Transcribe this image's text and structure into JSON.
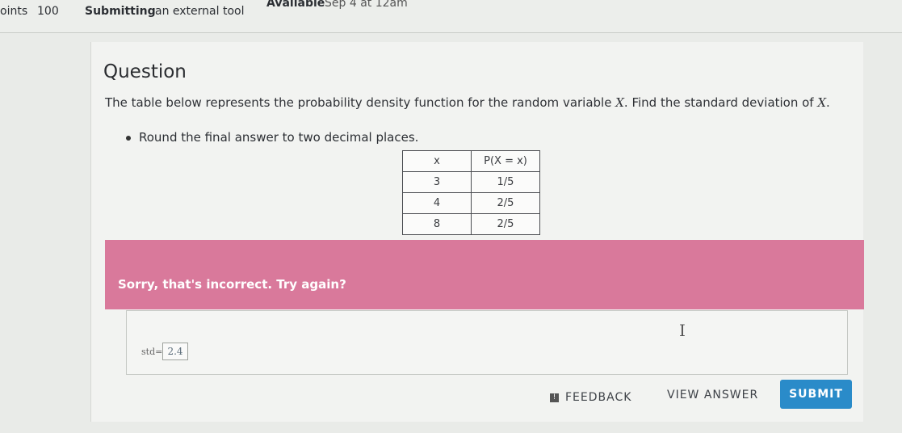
{
  "topbar": {
    "points_label": "oints",
    "points_value": "100",
    "submitting_label": "Submitting",
    "submitting_value": "an external tool",
    "available_label": "Available",
    "available_value": "Sep 4 at 12am"
  },
  "question": {
    "title": "Question",
    "prompt_before": "The table below represents the probability density function for the random variable ",
    "var": "X",
    "prompt_middle": ". Find the standard deviation of ",
    "prompt_after": ".",
    "bullet": "Round the final answer to two decimal places."
  },
  "table": {
    "headers": [
      "x",
      "P(X = x)"
    ],
    "rows": [
      [
        "3",
        "1/5"
      ],
      [
        "4",
        "2/5"
      ],
      [
        "8",
        "2/5"
      ]
    ]
  },
  "feedback": {
    "message": "Sorry, that's incorrect. Try again?"
  },
  "answer": {
    "label": "std=",
    "value": "2.4"
  },
  "actions": {
    "feedback_label": "FEEDBACK",
    "view_answer_label": "VIEW ANSWER",
    "submit_label": "SUBMIT"
  },
  "colors": {
    "error_banner": "#d9799b",
    "submit_button": "#2a8bc9"
  }
}
